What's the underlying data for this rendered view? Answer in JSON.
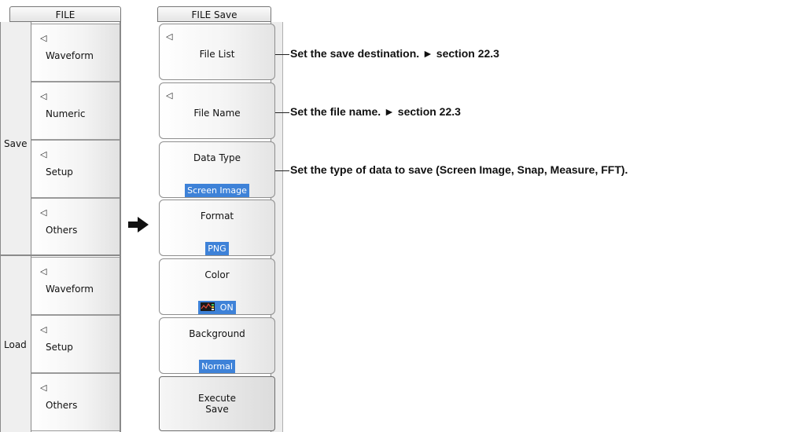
{
  "file_menu": {
    "title": "FILE",
    "save_label": "Save",
    "load_label": "Load",
    "save_items": [
      "Waveform",
      "Numeric",
      "Setup",
      "Others"
    ],
    "load_items": [
      "Waveform",
      "Setup",
      "Others"
    ]
  },
  "save_menu": {
    "title": "FILE Save",
    "file_list": "File List",
    "file_name": "File Name",
    "data_type": {
      "label": "Data Type",
      "value": "Screen Image"
    },
    "format": {
      "label": "Format",
      "value": "PNG"
    },
    "color": {
      "label": "Color",
      "value": "ON"
    },
    "background": {
      "label": "Background",
      "value": "Normal"
    },
    "execute": {
      "line1": "Execute",
      "line2": "Save"
    }
  },
  "annotations": {
    "destination": "Set the save destination. ► section 22.3",
    "file_name": "Set the file name. ► section 22.3",
    "data_type": "Set the type of data to save (Screen Image, Snap, Measure, FFT)."
  },
  "colors": {
    "highlight": "#3e82d8"
  },
  "icons": {
    "arrow": "right-arrow-icon",
    "submenu": "submenu-triangle-icon"
  }
}
